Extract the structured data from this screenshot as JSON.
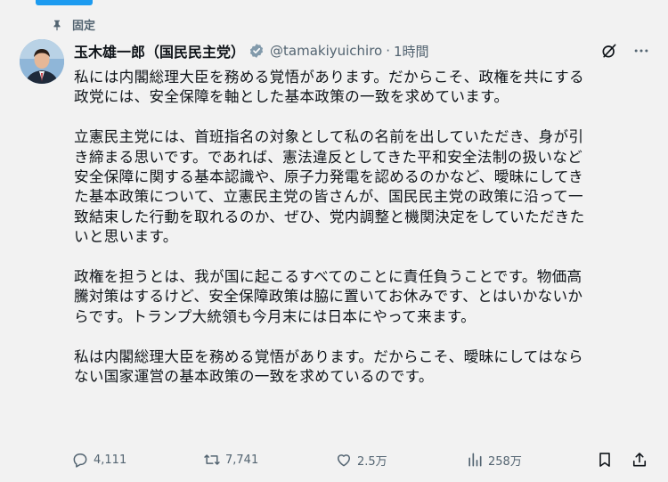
{
  "pinned": {
    "label": "固定"
  },
  "author": {
    "display_name": "玉木雄一郎（国民民主党）",
    "handle": "@tamakiyuichiro",
    "separator": "·",
    "time": "1時間"
  },
  "tweet": {
    "paragraphs": [
      "私には内閣総理大臣を務める覚悟があります。だからこそ、政権を共にする\n政党には、安全保障を軸とした基本政策の一致を求めています。",
      "立憲民主党には、首班指名の対象として私の名前を出していただき、身が引\nき締まる思いです。であれば、憲法違反としてきた平和安全法制の扱いなど\n安全保障に関する基本認識や、原子力発電を認めるのかなど、曖昧にしてき\nた基本政策について、立憲民主党の皆さんが、国民民主党の政策に沿って一\n致結束した行動を取れるのか、ぜひ、党内調整と機関決定をしていただきた\nいと思います。",
      "政権を担うとは、我が国に起こるすべてのことに責任負うことです。物価高\n騰対策はするけど、安全保障政策は脇に置いてお休みです、とはいかないか\nらです。トランプ大統領も今月末には日本にやって来ます。",
      "私は内閣総理大臣を務める覚悟があります。だからこそ、曖昧にしてはなら\nない国家運営の基本政策の一致を求めているのです。"
    ]
  },
  "actions": {
    "replies": "4,111",
    "reposts": "7,741",
    "likes": "2.5万",
    "views": "258万"
  },
  "icons": [
    "pin-icon",
    "verified-badge-icon",
    "grok-icon",
    "more-icon",
    "reply-icon",
    "repost-icon",
    "like-icon",
    "views-icon",
    "bookmark-icon",
    "share-icon"
  ],
  "colors": {
    "accent": "#1d9bf0",
    "text": "#0f1419",
    "muted": "#536471",
    "background": "#f2f2f2"
  }
}
